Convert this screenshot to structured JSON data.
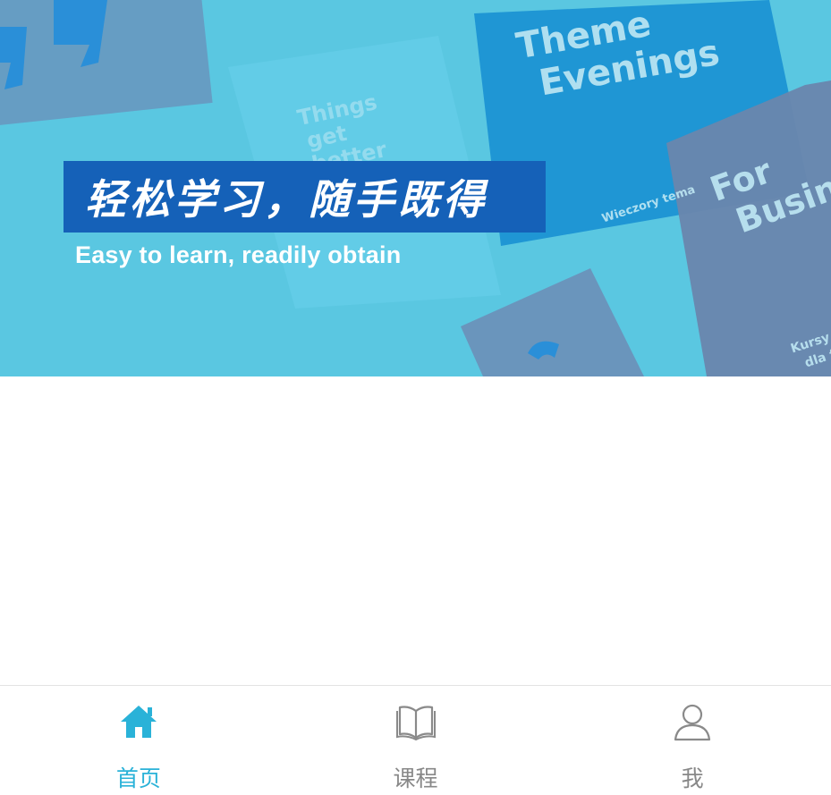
{
  "banner": {
    "headline": "轻松学习，随手既得",
    "subline": "Easy to learn, readily obtain",
    "card_texts": {
      "theme": [
        "Theme",
        "Evenings"
      ],
      "things": [
        "Things",
        "get",
        "better"
      ],
      "business": [
        "For",
        "Busine"
      ],
      "wieczory": "Wieczory tema",
      "kursy": [
        "Kursy j",
        "dla fir"
      ]
    }
  },
  "tabbar": {
    "tabs": [
      {
        "label": "首页",
        "icon": "home-icon",
        "active": true
      },
      {
        "label": "课程",
        "icon": "book-icon",
        "active": false
      },
      {
        "label": "我",
        "icon": "user-icon",
        "active": false
      }
    ]
  },
  "colors": {
    "accent": "#2ab2d8",
    "inactive": "#888888",
    "banner_bg": "#58c6e0",
    "headline_box": "#1561b8"
  }
}
